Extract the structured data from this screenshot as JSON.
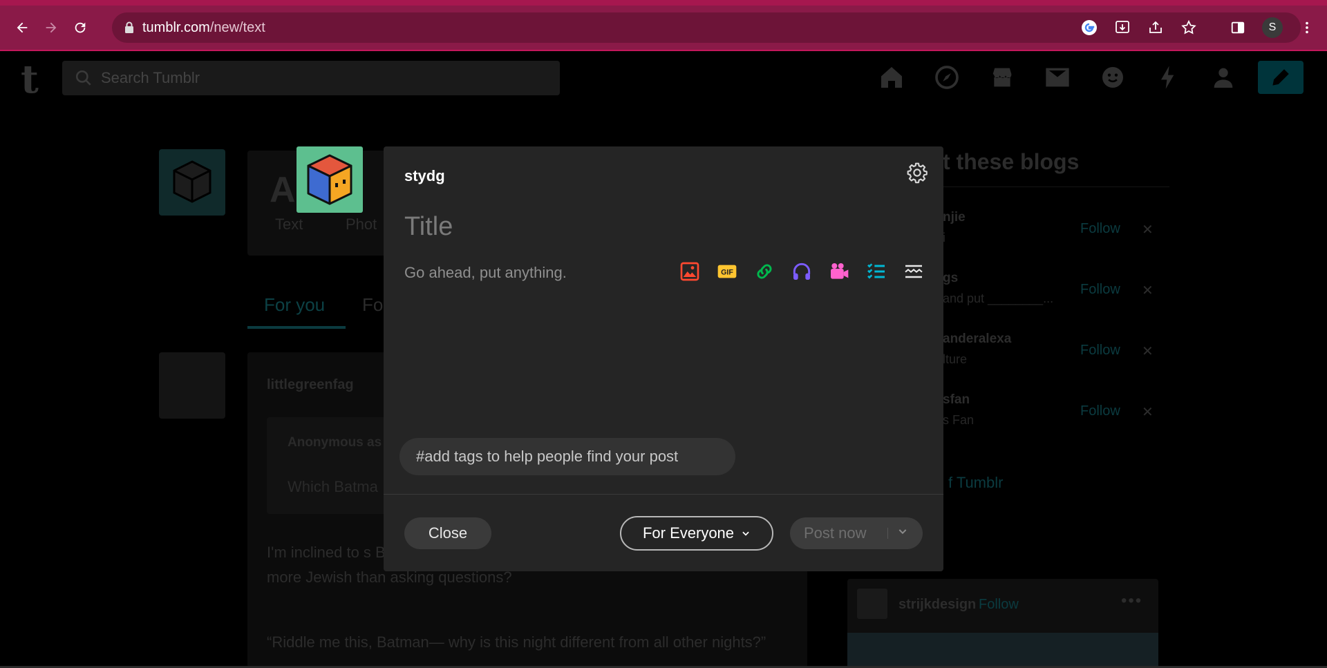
{
  "browser": {
    "url_host": "tumblr.com",
    "url_path": "/new/text",
    "profile_initial": "S"
  },
  "header": {
    "search_placeholder": "Search Tumblr"
  },
  "background": {
    "compose_a": "Aa",
    "text_label": "Text",
    "photo_label": "Phot",
    "tab_for_you": "For you",
    "tab_following": "Fo",
    "post_user": "littlegreenfag",
    "ask_user": "Anonymous as",
    "ask_question": "Which Batma",
    "post_para": "I'm inclined to s But personally, I think it's the Riddler. Because hey, what's more Jewish than asking questions?",
    "post_para2": "“Riddle me this, Batman— why is this night different from all other nights?”",
    "right_title": "t these blogs",
    "recommendations": [
      {
        "name": "njie",
        "sub": "i",
        "follow": "Follow"
      },
      {
        "name": "gs",
        "sub": "and put ________...",
        "follow": "Follow"
      },
      {
        "name": "anderalexa",
        "sub": "lture",
        "follow": "Follow"
      },
      {
        "name": "sfan",
        "sub": "s Fan",
        "follow": "Follow"
      }
    ],
    "explore_link": "f Tumblr",
    "card_user": "strijkdesign",
    "card_follow": "Follow"
  },
  "modal": {
    "blog_name": "stydg",
    "title_placeholder": "Title",
    "body_placeholder": "Go ahead, put anything.",
    "tags_placeholder": "#add tags to help people find your post",
    "close_label": "Close",
    "audience_label": "For Everyone",
    "post_label": "Post now",
    "media_icons": [
      "photo-icon",
      "gif-icon",
      "link-icon",
      "audio-icon",
      "video-icon",
      "checklist-icon",
      "divider-icon"
    ],
    "colors": {
      "photo": "#ff4930",
      "gif": "#ffc530",
      "link": "#00b84d",
      "audio": "#7c5cff",
      "video": "#ff62ce",
      "checklist": "#00b8d4",
      "divider": "#e8e8e8"
    }
  }
}
